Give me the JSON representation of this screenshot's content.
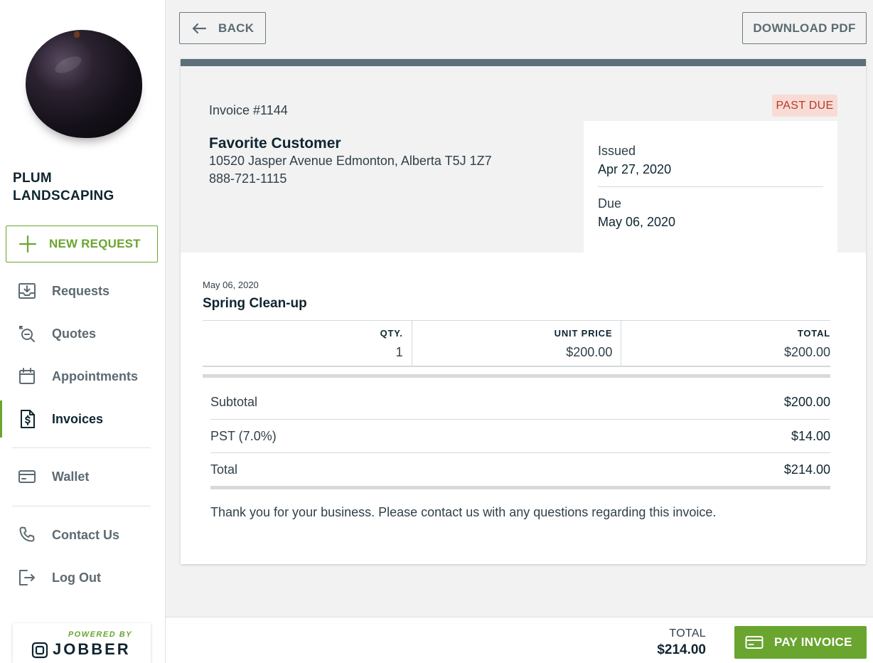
{
  "company": {
    "name": "PLUM LANDSCAPING",
    "logo_icon": "plum-logo"
  },
  "sidebar": {
    "new_request": {
      "label": "NEW REQUEST",
      "icon": "plus-icon"
    },
    "items": [
      {
        "label": "Requests",
        "icon": "inbox-download-icon"
      },
      {
        "label": "Quotes",
        "icon": "quote-search-icon"
      },
      {
        "label": "Appointments",
        "icon": "calendar-icon"
      },
      {
        "label": "Invoices",
        "icon": "dollar-document-icon",
        "active": true
      },
      {
        "label": "Wallet",
        "icon": "credit-card-icon"
      },
      {
        "label": "Contact Us",
        "icon": "phone-icon"
      },
      {
        "label": "Log Out",
        "icon": "logout-icon"
      }
    ],
    "powered_by": {
      "text": "POWERED BY",
      "brand": "JOBBER"
    }
  },
  "toolbar": {
    "back_label": "BACK",
    "download_label": "DOWNLOAD PDF"
  },
  "invoice": {
    "number": "Invoice #1144",
    "status": "PAST DUE",
    "customer": {
      "name": "Favorite Customer",
      "address": "10520 Jasper Avenue Edmonton, Alberta T5J 1Z7",
      "phone": "888-721-1115"
    },
    "issued_label": "Issued",
    "issued": "Apr 27, 2020",
    "due_label": "Due",
    "due": "May 06, 2020",
    "item": {
      "date": "May 06, 2020",
      "title": "Spring Clean-up",
      "columns": [
        "QTY.",
        "UNIT PRICE",
        "TOTAL"
      ],
      "values": [
        "1",
        "$200.00",
        "$200.00"
      ]
    },
    "summary": [
      {
        "label": "Subtotal",
        "value": "$200.00"
      },
      {
        "label": "PST (7.0%)",
        "value": "$14.00"
      },
      {
        "label": "Total",
        "value": "$214.00"
      }
    ],
    "message": "Thank you for your business. Please contact us with any questions regarding this invoice."
  },
  "footer": {
    "total_label": "TOTAL",
    "total_value": "$214.00",
    "pay_label": "PAY INVOICE"
  },
  "colors": {
    "accent": "#6aa52f",
    "badge_bg": "#f9dbd6",
    "badge_text": "#b23c26",
    "top_bar": "#5c6f7a"
  }
}
